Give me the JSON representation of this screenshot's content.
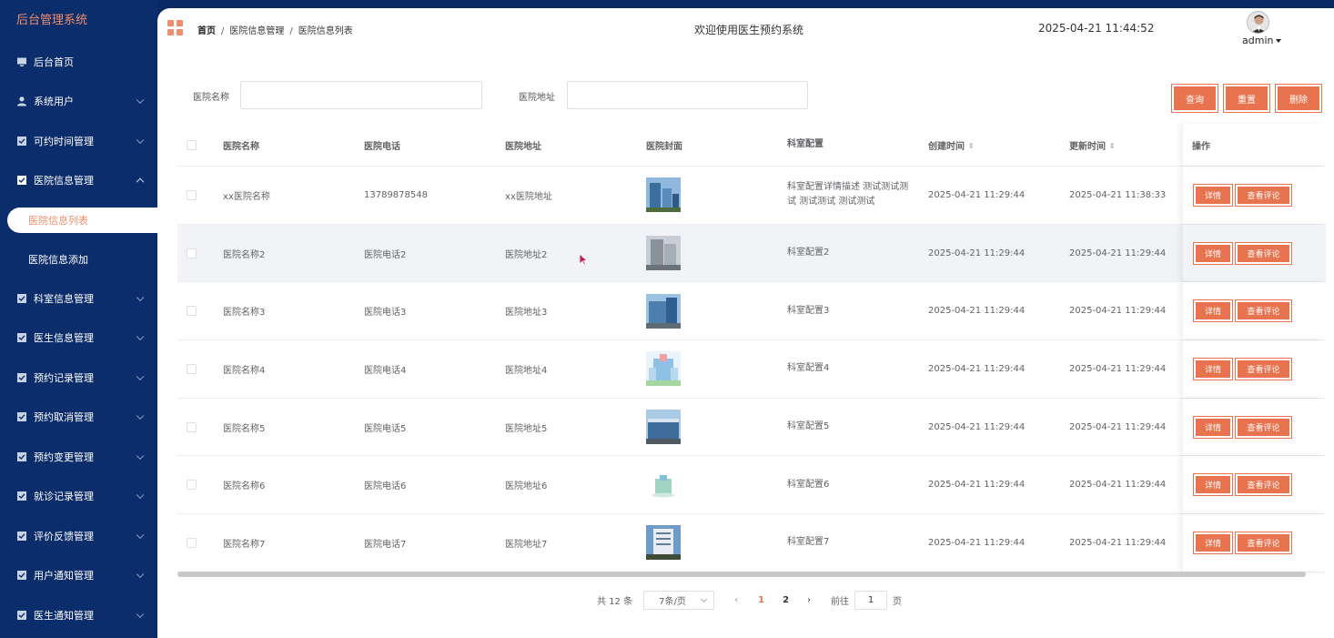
{
  "sidebar": {
    "brand": "后台管理系统",
    "items": [
      {
        "label": "后台首页",
        "icon": "monitor-icon"
      },
      {
        "label": "系统用户",
        "icon": "user-icon"
      },
      {
        "label": "可约时间管理",
        "icon": "checkbox-icon"
      },
      {
        "label": "医院信息管理",
        "icon": "checkbox-icon",
        "expanded": true,
        "children": [
          "医院信息列表",
          "医院信息添加"
        ]
      },
      {
        "label": "科室信息管理",
        "icon": "checkbox-icon"
      },
      {
        "label": "医生信息管理",
        "icon": "checkbox-icon"
      },
      {
        "label": "预约记录管理",
        "icon": "checkbox-icon"
      },
      {
        "label": "预约取消管理",
        "icon": "checkbox-icon"
      },
      {
        "label": "预约变更管理",
        "icon": "checkbox-icon"
      },
      {
        "label": "就诊记录管理",
        "icon": "checkbox-icon"
      },
      {
        "label": "评价反馈管理",
        "icon": "checkbox-icon"
      },
      {
        "label": "用户通知管理",
        "icon": "checkbox-icon"
      },
      {
        "label": "医生通知管理",
        "icon": "checkbox-icon"
      }
    ],
    "active_child": "医院信息列表"
  },
  "header": {
    "breadcrumb": [
      "首页",
      "医院信息管理",
      "医院信息列表"
    ],
    "welcome": "欢迎使用医生预约系统",
    "datetime": "2025-04-21 11:44:52",
    "user": "admin"
  },
  "search": {
    "name_label": "医院名称",
    "name_value": "",
    "addr_label": "医院地址",
    "addr_value": "",
    "query": "查询",
    "reset": "重置",
    "delete": "删除"
  },
  "table": {
    "columns": [
      "医院名称",
      "医院电话",
      "医院地址",
      "医院封面",
      "科室配置",
      "创建时间",
      "更新时间",
      "操作"
    ],
    "rows": [
      {
        "name": "xx医院名称",
        "tel": "13789878548",
        "addr": "xx医院地址",
        "cfg": "科室配置详情描述 测试测试测试 测试测试 测试测试",
        "created": "2025-04-21 11:29:44",
        "updated": "2025-04-21 11:38:33"
      },
      {
        "name": "医院名称2",
        "tel": "医院电话2",
        "addr": "医院地址2",
        "cfg": "科室配置2",
        "created": "2025-04-21 11:29:44",
        "updated": "2025-04-21 11:29:44"
      },
      {
        "name": "医院名称3",
        "tel": "医院电话3",
        "addr": "医院地址3",
        "cfg": "科室配置3",
        "created": "2025-04-21 11:29:44",
        "updated": "2025-04-21 11:29:44"
      },
      {
        "name": "医院名称4",
        "tel": "医院电话4",
        "addr": "医院地址4",
        "cfg": "科室配置4",
        "created": "2025-04-21 11:29:44",
        "updated": "2025-04-21 11:29:44"
      },
      {
        "name": "医院名称5",
        "tel": "医院电话5",
        "addr": "医院地址5",
        "cfg": "科室配置5",
        "created": "2025-04-21 11:29:44",
        "updated": "2025-04-21 11:29:44"
      },
      {
        "name": "医院名称6",
        "tel": "医院电话6",
        "addr": "医院地址6",
        "cfg": "科室配置6",
        "created": "2025-04-21 11:29:44",
        "updated": "2025-04-21 11:29:44"
      },
      {
        "name": "医院名称7",
        "tel": "医院电话7",
        "addr": "医院地址7",
        "cfg": "科室配置7",
        "created": "2025-04-21 11:29:44",
        "updated": "2025-04-21 11:29:44"
      }
    ],
    "detail_label": "详情",
    "review_label": "查看评论"
  },
  "pagination": {
    "total": "共 12 条",
    "page_size": "7条/页",
    "pages": [
      "1",
      "2"
    ],
    "current": "1",
    "goto_prefix": "前往",
    "goto_value": "1",
    "goto_suffix": "页"
  },
  "colors": {
    "accent": "#e8734f",
    "sidebar": "#0b2d6b",
    "brand": "#f08e6b"
  }
}
